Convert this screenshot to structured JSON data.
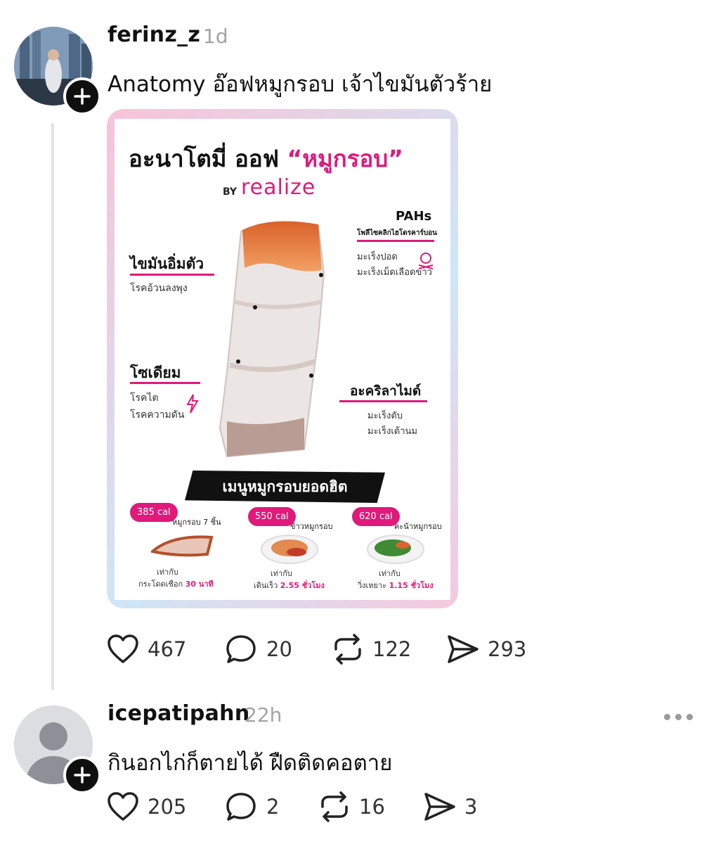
{
  "post1": {
    "username": "ferinz_z",
    "time": "1d",
    "text": "Anatomy อ๊อฟหมูกรอบ เจ้าไขมันตัวร้าย",
    "image": {
      "title_plain": "อะนาโตมี่ ออฟ",
      "title_highlight": "“หมูกรอบ”",
      "by": "BY",
      "brand": "realize",
      "pahs_title": "PAHs",
      "pahs_sub": "โพลีไซคลิกไฮโดรคาร์บอน",
      "pahs_effects": [
        "มะเร็งปอด",
        "มะเร็งเม็ดเลือดขาว"
      ],
      "fat_title": "ไขมันอิ่มตัว",
      "fat_effects": [
        "โรคอ้วนลงพุง"
      ],
      "sodium_title": "โซเดียม",
      "sodium_effects": [
        "โรคไต",
        "โรคความดัน"
      ],
      "acryl_title": "อะคริลาไมด์",
      "acryl_effects": [
        "มะเร็งตับ",
        "มะเร็งเต้านม"
      ],
      "banner": "เมนูหมูกรอบยอดฮิต",
      "menu": [
        {
          "cal": "385 cal",
          "name": "หมูกรอบ 7 ชิ้น",
          "eq": "เท่ากับ",
          "activity": "กระโดดเชือก",
          "amount": "30 นาที"
        },
        {
          "cal": "550 cal",
          "name": "ข้าวหมูกรอบ",
          "eq": "เท่ากับ",
          "activity": "เดินเร็ว",
          "amount": "2.55 ชั่วโมง"
        },
        {
          "cal": "620 cal",
          "name": "คะน้าหมูกรอบ",
          "eq": "เท่ากับ",
          "activity": "วิ่งเหยาะ",
          "amount": "1.15 ชั่วโมง"
        }
      ]
    },
    "likes": "467",
    "replies": "20",
    "reposts": "122",
    "shares": "293"
  },
  "post2": {
    "username": "icepatipahn",
    "time": "22h",
    "text": "กินอกไก่ก็ตายได้ ฝืดติดคอตาย",
    "likes": "205",
    "replies": "2",
    "reposts": "16",
    "shares": "3"
  },
  "colors": {
    "accent": "#e0197a",
    "text": "#111111",
    "muted": "#a3a3a3"
  }
}
